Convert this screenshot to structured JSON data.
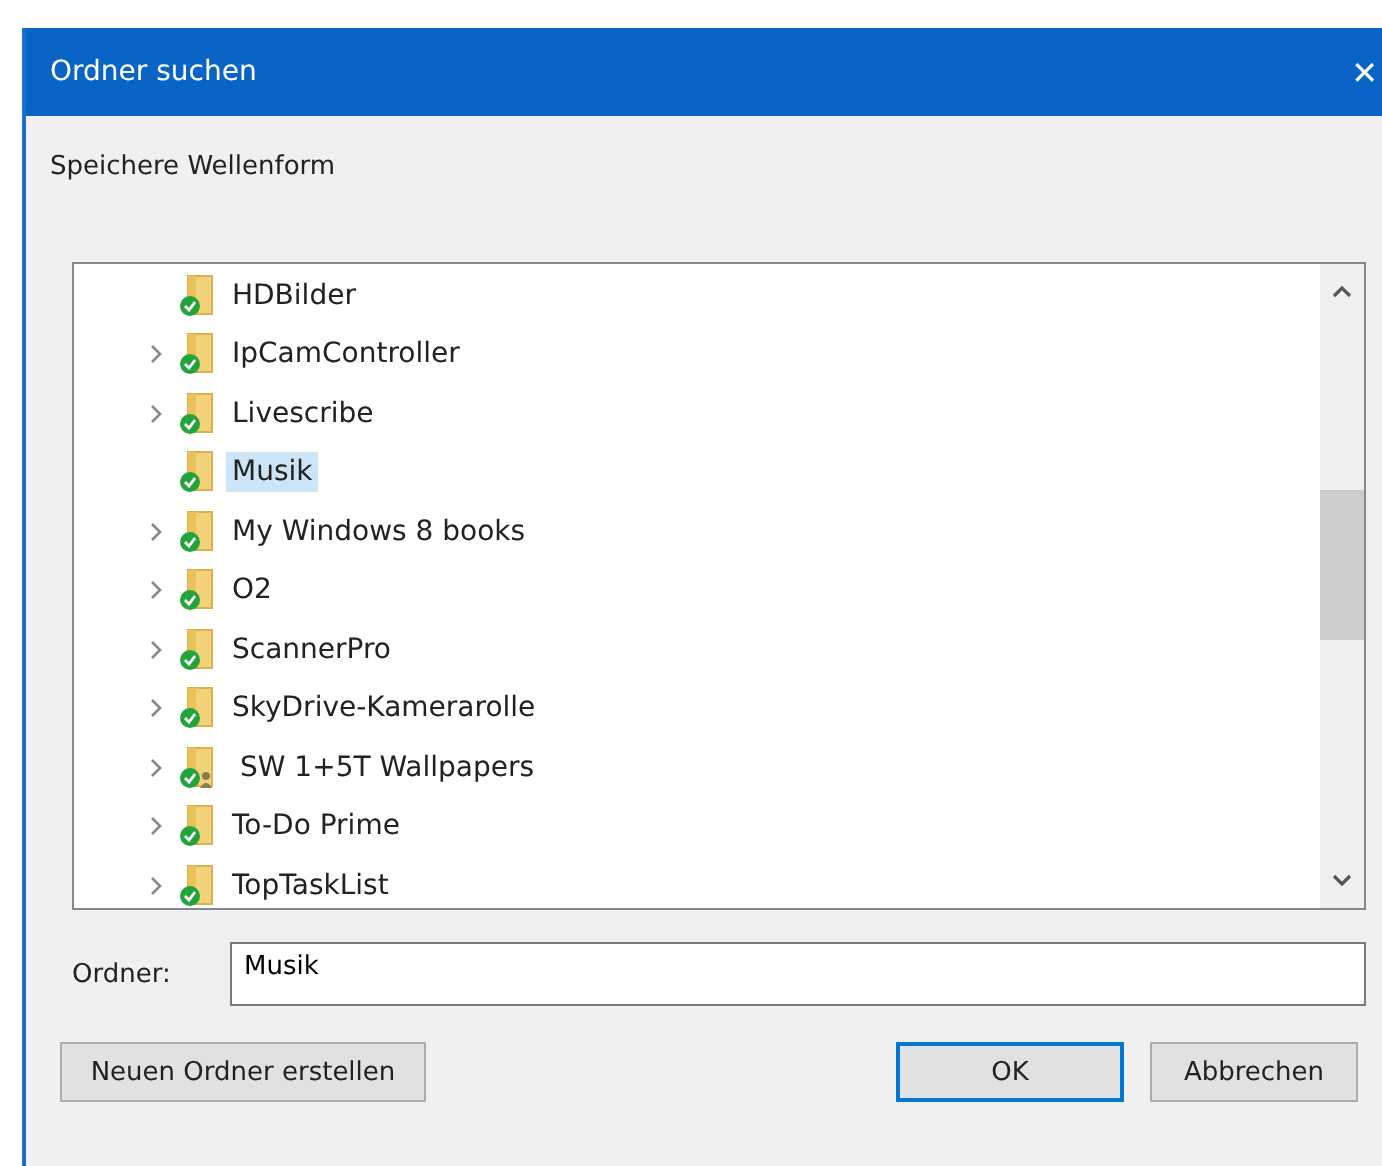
{
  "window": {
    "title": "Ordner suchen",
    "close": "✕"
  },
  "description": "Speichere Wellenform",
  "tree": {
    "items": [
      {
        "label": "HDBilder",
        "expandable": false,
        "selected": false,
        "shared": false
      },
      {
        "label": "IpCamController",
        "expandable": true,
        "selected": false,
        "shared": false
      },
      {
        "label": "Livescribe",
        "expandable": true,
        "selected": false,
        "shared": false
      },
      {
        "label": "Musik",
        "expandable": false,
        "selected": true,
        "shared": false
      },
      {
        "label": "My Windows 8 books",
        "expandable": true,
        "selected": false,
        "shared": false
      },
      {
        "label": "O2",
        "expandable": true,
        "selected": false,
        "shared": false
      },
      {
        "label": "ScannerPro",
        "expandable": true,
        "selected": false,
        "shared": false
      },
      {
        "label": "SkyDrive-Kamerarolle",
        "expandable": true,
        "selected": false,
        "shared": false
      },
      {
        "label": "SW 1+5T Wallpapers",
        "expandable": true,
        "selected": false,
        "shared": true
      },
      {
        "label": "To-Do Prime",
        "expandable": true,
        "selected": false,
        "shared": false
      },
      {
        "label": "TopTaskList",
        "expandable": true,
        "selected": false,
        "shared": false
      }
    ]
  },
  "folder_field": {
    "label": "Ordner:",
    "value": "Musik"
  },
  "buttons": [
    {
      "label": "Neuen Ordner erstellen",
      "default": false
    },
    {
      "label": "OK",
      "default": true
    },
    {
      "label": "Abbrechen",
      "default": false
    }
  ]
}
